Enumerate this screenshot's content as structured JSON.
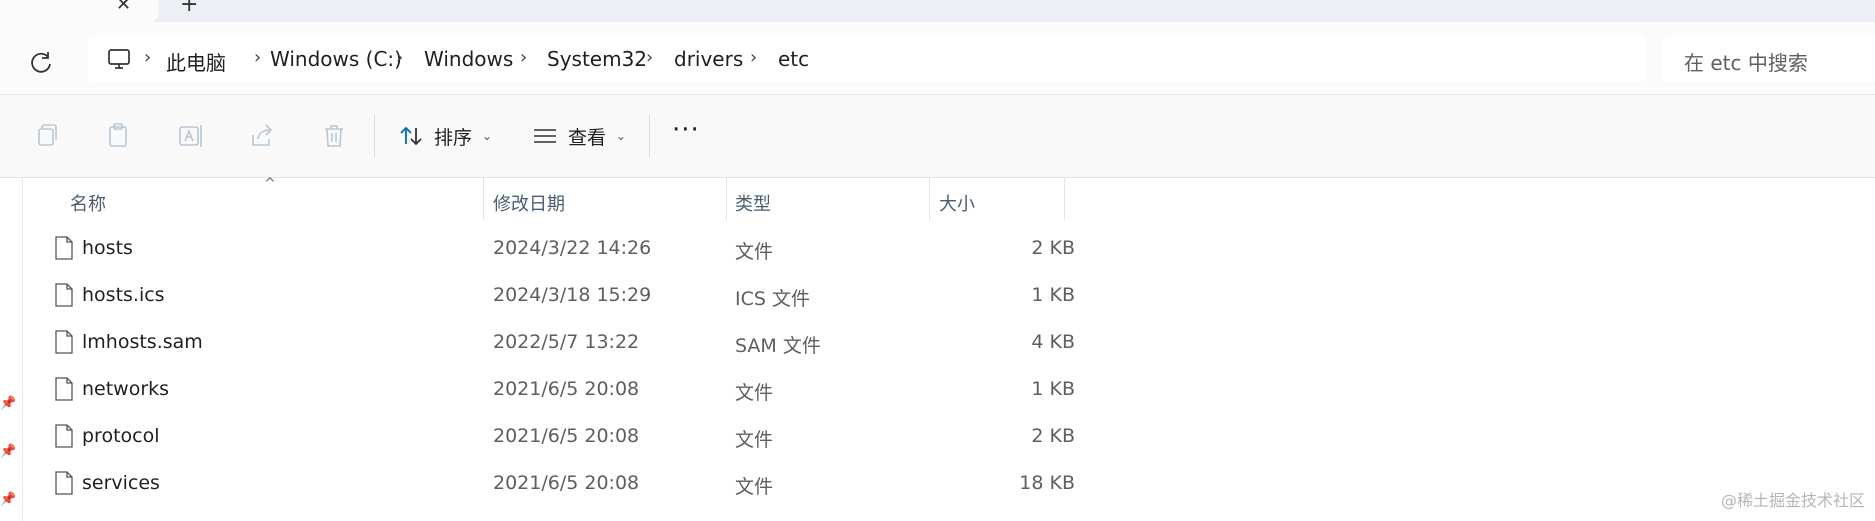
{
  "tab": {
    "close_glyph": "✕",
    "new_glyph": "+"
  },
  "breadcrumb": [
    "此电脑",
    "Windows (C:)",
    "Windows",
    "System32",
    "drivers",
    "etc"
  ],
  "search": {
    "placeholder": "在 etc 中搜索"
  },
  "toolbar": {
    "sort_label": "排序",
    "view_label": "查看",
    "more_label": "···",
    "icons": [
      "copy-icon",
      "paste-icon",
      "rename-icon",
      "share-icon",
      "delete-icon"
    ]
  },
  "columns": {
    "name": "名称",
    "date": "修改日期",
    "type": "类型",
    "size": "大小"
  },
  "files": [
    {
      "name": "hosts",
      "date": "2024/3/22 14:26",
      "type": "文件",
      "size": "2 KB"
    },
    {
      "name": "hosts.ics",
      "date": "2024/3/18 15:29",
      "type": "ICS 文件",
      "size": "1 KB"
    },
    {
      "name": "lmhosts.sam",
      "date": "2022/5/7 13:22",
      "type": "SAM 文件",
      "size": "4 KB"
    },
    {
      "name": "networks",
      "date": "2021/6/5 20:08",
      "type": "文件",
      "size": "1 KB"
    },
    {
      "name": "protocol",
      "date": "2021/6/5 20:08",
      "type": "文件",
      "size": "2 KB"
    },
    {
      "name": "services",
      "date": "2021/6/5 20:08",
      "type": "文件",
      "size": "18 KB"
    }
  ],
  "watermark": "@稀土掘金技术社区",
  "colors": {
    "accent": "#0067c0",
    "header_text": "#4a5d72",
    "muted_text": "#5e5e5e"
  }
}
